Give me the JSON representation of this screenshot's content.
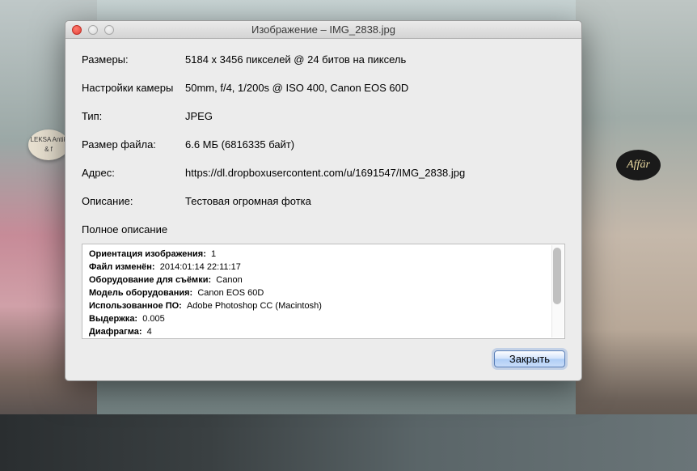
{
  "window": {
    "title": "Изображение – IMG_2838.jpg"
  },
  "fields": {
    "dimensions": {
      "label": "Размеры:",
      "value": "5184 x 3456 пикселей @ 24 битов на пиксель"
    },
    "camera": {
      "label": "Настройки камеры",
      "value": "50mm, f/4, 1/200s @ ISO 400, Canon EOS 60D"
    },
    "type": {
      "label": "Тип:",
      "value": "JPEG"
    },
    "filesize": {
      "label": "Размер файла:",
      "value": "6.6 МБ (6816335 байт)"
    },
    "address": {
      "label": "Адрес:",
      "value": "https://dl.dropboxusercontent.com/u/1691547/IMG_2838.jpg"
    },
    "description": {
      "label": "Описание:",
      "value": "Тестовая огромная фотка"
    }
  },
  "full_description_label": "Полное описание",
  "details": {
    "orientation": {
      "key": "Ориентация изображения:",
      "value": "1"
    },
    "modified": {
      "key": "Файл изменён:",
      "value": "2014:01:14 22:11:17"
    },
    "make": {
      "key": "Оборудование для съёмки:",
      "value": "Canon"
    },
    "model": {
      "key": "Модель оборудования:",
      "value": "Canon EOS 60D"
    },
    "software": {
      "key": "Использованное ПО:",
      "value": "Adobe Photoshop CC (Macintosh)"
    },
    "exposure": {
      "key": "Выдержка:",
      "value": "0.005"
    },
    "aperture": {
      "key": "Диафрагма:",
      "value": "4"
    }
  },
  "buttons": {
    "close": "Закрыть"
  },
  "decor": {
    "sign_right": "Affär",
    "sign_left": "LEKSA\nAntik & f"
  }
}
